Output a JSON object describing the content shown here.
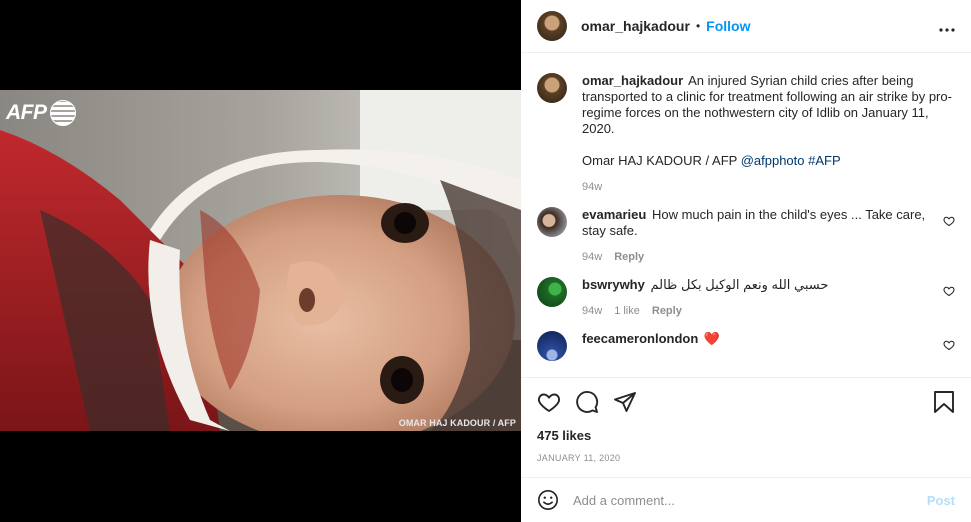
{
  "header": {
    "username": "omar_hajkadour",
    "separator": "•",
    "follow_label": "Follow",
    "more_label": "•••"
  },
  "media": {
    "logo_text": "AFP",
    "photo_credit": "OMAR HAJ KADOUR / AFP"
  },
  "caption": {
    "username": "omar_hajkadour",
    "text": "An injured Syrian child cries after being transported to a clinic for treatment following an air strike by pro-regime forces on the nothwestern city of Idlib on January 11, 2020.",
    "credit_prefix": "Omar HAJ KADOUR / AFP",
    "mention": "@afpphoto",
    "hashtag": "#AFP",
    "time": "94w"
  },
  "comments": [
    {
      "username": "evamarieu",
      "text": "How much pain in the child's eyes ... Take care, stay safe.",
      "time": "94w",
      "likes": "",
      "reply_label": "Reply"
    },
    {
      "username": "bswrywhy",
      "text": "حسبي الله ونعم الوكيل بكل ظالم",
      "time": "94w",
      "likes": "1 like",
      "reply_label": "Reply"
    },
    {
      "username": "feecameronlondon",
      "text": "❤️",
      "time": "",
      "likes": "",
      "reply_label": ""
    }
  ],
  "actions": {
    "likes": "475 likes",
    "date": "JANUARY 11, 2020"
  },
  "add_comment": {
    "placeholder": "Add a comment...",
    "post_label": "Post"
  },
  "colors": {
    "link_blue": "#0095f6",
    "hashtag_blue": "#00376b",
    "post_disabled": "#b2dffc",
    "heart_red": "#ed4956",
    "secondary_text": "#8e8e8e"
  },
  "icons": [
    "more-icon",
    "heart-icon",
    "comment-icon",
    "share-icon",
    "save-icon",
    "emoji-icon",
    "small-heart-icon",
    "afp-logo"
  ]
}
